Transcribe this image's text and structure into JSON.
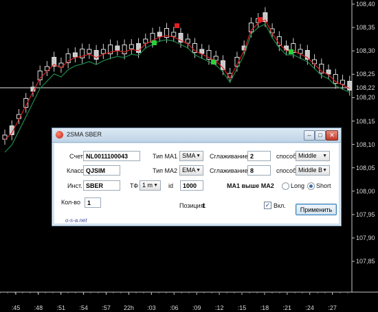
{
  "price_axis": {
    "labels": [
      "108,40",
      "108,35",
      "108,30",
      "108,25",
      "108,20",
      "108,15",
      "108,10",
      "108,05",
      "108,00",
      "107,95",
      "107,90",
      "107,85"
    ],
    "current": "108,22"
  },
  "time_axis": {
    "labels": [
      ":45",
      ":48",
      ":51",
      ":54",
      ":57",
      "22h",
      ":03",
      ":06",
      ":09",
      ":12",
      ":15",
      ":18",
      ":21",
      ":24",
      ":27"
    ]
  },
  "dialog": {
    "title": "2SMA SBER",
    "window_buttons": {
      "minimize": "–",
      "maximize": "□",
      "close": "✕"
    },
    "account_label": "Счет",
    "account_value": "NL0011100043",
    "class_label": "Класс",
    "class_value": "QJSIM",
    "instrument_label": "Инст.",
    "instrument_value": "SBER",
    "qty_label": "Кол-во",
    "qty_value": "1",
    "ma1_type_label": "Тип МА1",
    "ma1_type_value": "SMA",
    "ma2_type_label": "Тип МА2",
    "ma2_type_value": "EMA",
    "tf_label": "ТФ",
    "tf_value": "1 m",
    "id_label": "id",
    "id_value": "1000",
    "smoothing1_label": "Сглаживание",
    "smoothing1_value": "2",
    "smoothing2_label": "Сглаживание",
    "smoothing2_value": "8",
    "method1_label": "способ",
    "method1_value": "Middle",
    "method2_label": "способ",
    "method2_value": "Middle B",
    "status_text": "МА1 выше МА2",
    "long_label": "Long",
    "short_label": "Short",
    "selected_side": "Short",
    "position_label": "Позиция:",
    "position_value": "1",
    "enabled_label": "Вкл.",
    "enabled_checked": true,
    "apply_label": "Применить",
    "site_link": "o-s-a.net"
  },
  "colors": {
    "background": "#000000",
    "candle_up": "#ffffff",
    "candle_down": "#c0c0c0",
    "ma1": "#e02020",
    "ma2": "#1f8a4c"
  }
}
